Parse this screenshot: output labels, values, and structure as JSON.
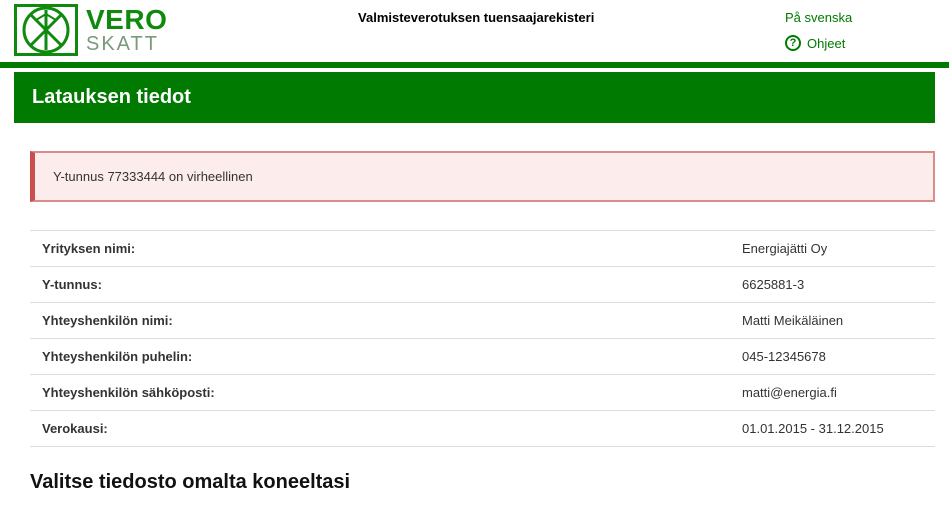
{
  "header": {
    "app_title": "Valmisteverotuksen tuensaajarekisteri",
    "logo_top": "VERO",
    "logo_bottom": "SKATT",
    "lang_link": "På svenska",
    "help_link": "Ohjeet"
  },
  "page": {
    "title": "Latauksen tiedot",
    "error_message": "Y-tunnus 77333444 on virheellinen",
    "section_heading": "Valitse tiedosto omalta koneeltasi"
  },
  "info": {
    "company_name_label": "Yrityksen nimi:",
    "company_name_value": "Energiajätti Oy",
    "business_id_label": "Y-tunnus:",
    "business_id_value": "6625881-3",
    "contact_name_label": "Yhteyshenkilön nimi:",
    "contact_name_value": "Matti Meikäläinen",
    "contact_phone_label": "Yhteyshenkilön puhelin:",
    "contact_phone_value": "045-12345678",
    "contact_email_label": "Yhteyshenkilön sähköposti:",
    "contact_email_value": "matti@energia.fi",
    "tax_period_label": "Verokausi:",
    "tax_period_value": "01.01.2015 - 31.12.2015"
  }
}
